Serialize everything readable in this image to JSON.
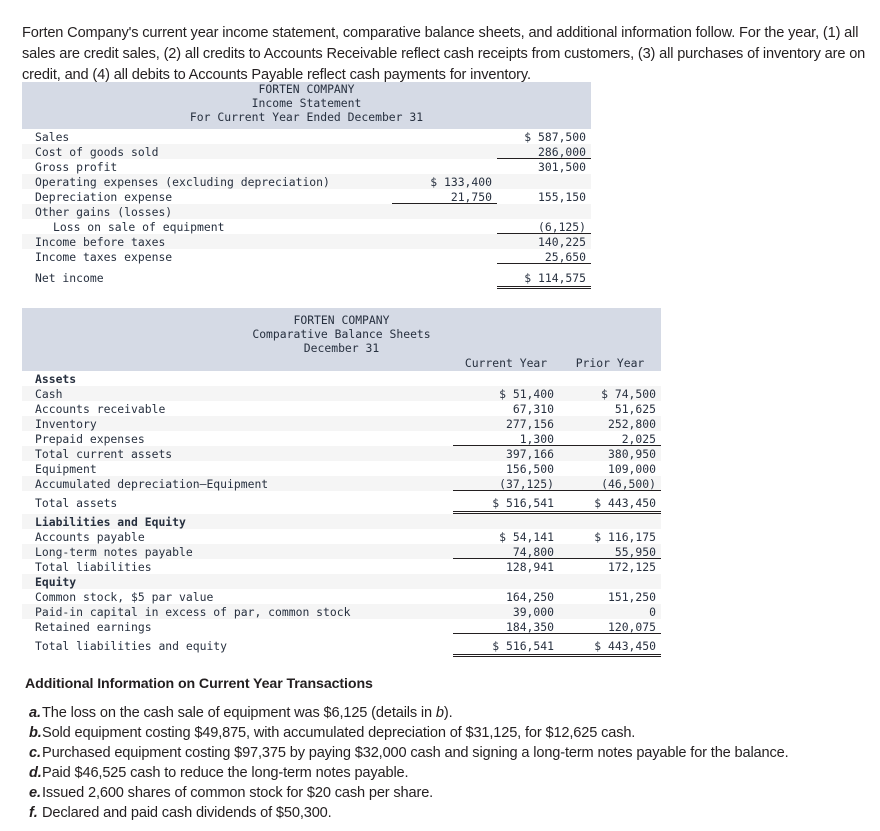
{
  "intro": {
    "text": "Forten Company's current year income statement, comparative balance sheets, and additional information follow. For the year, (1) all sales are credit sales, (2) all credits to Accounts Receivable reflect cash receipts from customers, (3) all purchases of inventory are on credit, and (4) all debits to Accounts Payable reflect cash payments for inventory."
  },
  "income_statement": {
    "company": "FORTEN COMPANY",
    "title": "Income Statement",
    "period": "For Current Year Ended December 31",
    "rows": [
      {
        "label": "Sales",
        "col1": "",
        "col2": "$ 587,500"
      },
      {
        "label": "Cost of goods sold",
        "col1": "",
        "col2": "286,000"
      },
      {
        "label": "Gross profit",
        "col1": "",
        "col2": "301,500"
      },
      {
        "label": "Operating expenses (excluding depreciation)",
        "col1": "$ 133,400",
        "col2": ""
      },
      {
        "label": "Depreciation expense",
        "col1": "21,750",
        "col2": "155,150"
      },
      {
        "label": "Other gains (losses)",
        "col1": "",
        "col2": ""
      },
      {
        "label": "Loss on sale of equipment",
        "col1": "",
        "col2": "(6,125)"
      },
      {
        "label": "Income before taxes",
        "col1": "",
        "col2": "140,225"
      },
      {
        "label": "Income taxes expense",
        "col1": "",
        "col2": "25,650"
      },
      {
        "label": "Net income",
        "col1": "",
        "col2": "$ 114,575"
      }
    ]
  },
  "balance_sheet": {
    "company": "FORTEN COMPANY",
    "title": "Comparative Balance Sheets",
    "period": "December 31",
    "columns": {
      "current": "Current Year",
      "prior": "Prior Year"
    },
    "rows": [
      {
        "label": "Assets",
        "current": "",
        "prior": ""
      },
      {
        "label": "Cash",
        "current": "$ 51,400",
        "prior": "$ 74,500"
      },
      {
        "label": "Accounts receivable",
        "current": "67,310",
        "prior": "51,625"
      },
      {
        "label": "Inventory",
        "current": "277,156",
        "prior": "252,800"
      },
      {
        "label": "Prepaid expenses",
        "current": "1,300",
        "prior": "2,025"
      },
      {
        "label": "Total current assets",
        "current": "397,166",
        "prior": "380,950"
      },
      {
        "label": "Equipment",
        "current": "156,500",
        "prior": "109,000"
      },
      {
        "label": "Accumulated depreciation—Equipment",
        "current": "(37,125)",
        "prior": "(46,500)"
      },
      {
        "label": "Total assets",
        "current": "$ 516,541",
        "prior": "$ 443,450"
      },
      {
        "label": "Liabilities and Equity",
        "current": "",
        "prior": ""
      },
      {
        "label": "Accounts payable",
        "current": "$ 54,141",
        "prior": "$ 116,175"
      },
      {
        "label": "Long-term notes payable",
        "current": "74,800",
        "prior": "55,950"
      },
      {
        "label": "Total liabilities",
        "current": "128,941",
        "prior": "172,125"
      },
      {
        "label": "Equity",
        "current": "",
        "prior": ""
      },
      {
        "label": "Common stock, $5 par value",
        "current": "164,250",
        "prior": "151,250"
      },
      {
        "label": "Paid-in capital in excess of par, common stock",
        "current": "39,000",
        "prior": "0"
      },
      {
        "label": "Retained earnings",
        "current": "184,350",
        "prior": "120,075"
      },
      {
        "label": "Total liabilities and equity",
        "current": "$ 516,541",
        "prior": "$ 443,450"
      }
    ]
  },
  "additional_info": {
    "heading": "Additional Information on Current Year Transactions",
    "items": [
      {
        "marker": "a.",
        "pre": "The loss on the cash sale of equipment was $6,125 (details in ",
        "em": "b",
        "post": ")."
      },
      {
        "marker": "b.",
        "pre": "Sold equipment costing $49,875, with accumulated depreciation of $31,125, for $12,625 cash.",
        "em": "",
        "post": ""
      },
      {
        "marker": "c.",
        "pre": "Purchased equipment costing $97,375 by paying $32,000 cash and signing a long-term notes payable for the balance.",
        "em": "",
        "post": ""
      },
      {
        "marker": "d.",
        "pre": "Paid $46,525 cash to reduce the long-term notes payable.",
        "em": "",
        "post": ""
      },
      {
        "marker": "e.",
        "pre": "Issued 2,600 shares of common stock for $20 cash per share.",
        "em": "",
        "post": ""
      },
      {
        "marker": "f.",
        "pre": "Declared and paid cash dividends of $50,300.",
        "em": "",
        "post": ""
      }
    ]
  },
  "colors": {
    "band_background": "#d5dae5",
    "row_shade": "#f5f5f5",
    "text": "#231f20",
    "table_text": "#27303f"
  }
}
